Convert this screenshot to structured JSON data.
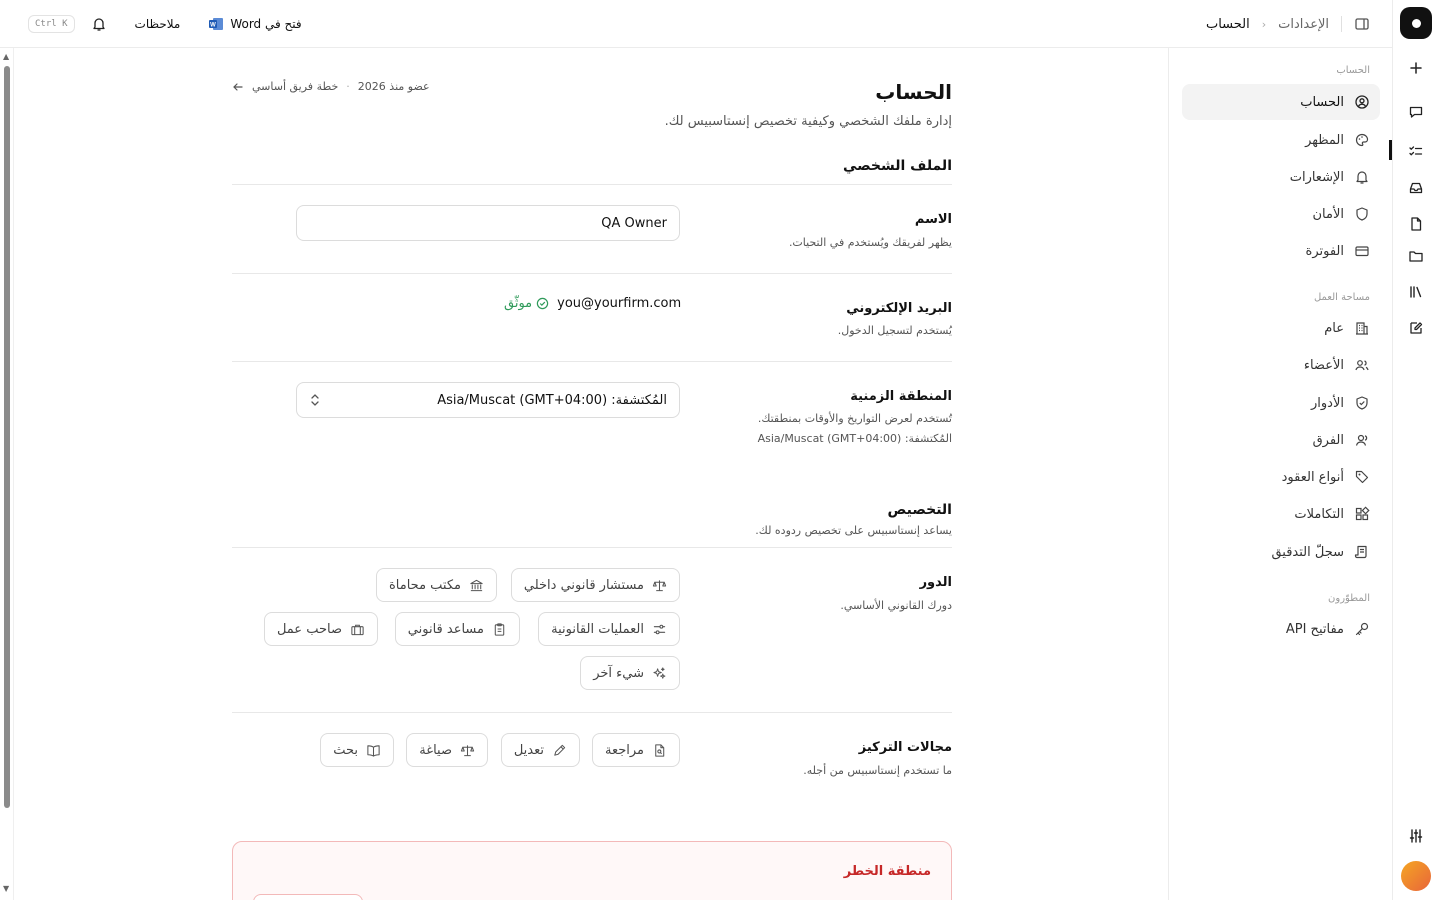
{
  "topbar": {
    "breadcrumb": [
      "الإعدادات",
      "الحساب"
    ],
    "search_shortcut": "Ctrl K",
    "notes_label": "ملاحظات",
    "open_in_word_label": "فتح في Word"
  },
  "sidebar": {
    "sections": [
      {
        "title": "الحساب",
        "items": [
          {
            "label": "الحساب",
            "icon": "user-circle-icon",
            "active": true
          },
          {
            "label": "المظهر",
            "icon": "palette-icon"
          },
          {
            "label": "الإشعارات",
            "icon": "bell-icon"
          },
          {
            "label": "الأمان",
            "icon": "shield-icon"
          },
          {
            "label": "الفوترة",
            "icon": "credit-card-icon"
          }
        ]
      },
      {
        "title": "مساحة العمل",
        "items": [
          {
            "label": "عام",
            "icon": "building-icon"
          },
          {
            "label": "الأعضاء",
            "icon": "users-icon"
          },
          {
            "label": "الأدوار",
            "icon": "shield-check-icon"
          },
          {
            "label": "الفرق",
            "icon": "team-icon"
          },
          {
            "label": "أنواع العقود",
            "icon": "tag-icon"
          },
          {
            "label": "التكاملات",
            "icon": "puzzle-icon"
          },
          {
            "label": "سجلّ التدقيق",
            "icon": "scroll-icon"
          }
        ]
      },
      {
        "title": "المطوّرون",
        "items": [
          {
            "label": "مفاتيح API",
            "icon": "key-icon"
          }
        ]
      }
    ]
  },
  "main": {
    "title": "الحساب",
    "subtitle": "إدارة ملفك الشخصي وكيفية تخصيص إنستاسبيس لك.",
    "member_since": "عضو منذ 2026",
    "plan_label": "خطة فريق أساسي",
    "profile_section": "الملف الشخصي",
    "name": {
      "label": "الاسم",
      "help": "يظهر لفريقك ويُستخدم في التحيات.",
      "value": "QA Owner"
    },
    "email": {
      "label": "البريد الإلكتروني",
      "help": "يُستخدم لتسجيل الدخول.",
      "value": "you@yourfirm.com",
      "verified_label": "موثّق"
    },
    "timezone": {
      "label": "المنطقة الزمنية",
      "help": "تُستخدم لعرض التواريخ والأوقات بمنطقتك.",
      "detected": "المُكتشفة: Asia/Muscat (GMT+04:00)",
      "value": "المُكتشفة: (GMT+04:00) Asia/Muscat"
    },
    "personalization": {
      "title": "التخصيص",
      "desc": "يساعد إنستاسبيس على تخصيص ردوده لك."
    },
    "role": {
      "label": "الدور",
      "help": "دورك القانوني الأساسي.",
      "options": [
        {
          "label": "مستشار قانوني داخلي",
          "icon": "scale-icon"
        },
        {
          "label": "مكتب محاماة",
          "icon": "bank-icon"
        },
        {
          "label": "العمليات القانونية",
          "icon": "sliders-icon"
        },
        {
          "label": "مساعد قانوني",
          "icon": "clipboard-icon"
        },
        {
          "label": "صاحب عمل",
          "icon": "briefcase-icon"
        },
        {
          "label": "شيء آخر",
          "icon": "sparkles-icon"
        }
      ]
    },
    "focus": {
      "label": "مجالات التركيز",
      "help": "ما تستخدم إنستاسبيس من أجله.",
      "options": [
        {
          "label": "مراجعة",
          "icon": "file-search-icon"
        },
        {
          "label": "تعديل",
          "icon": "pencil-icon"
        },
        {
          "label": "صياغة",
          "icon": "scale-icon"
        },
        {
          "label": "بحث",
          "icon": "book-icon"
        }
      ]
    },
    "danger_zone": {
      "title": "منطقة الخطر"
    }
  }
}
